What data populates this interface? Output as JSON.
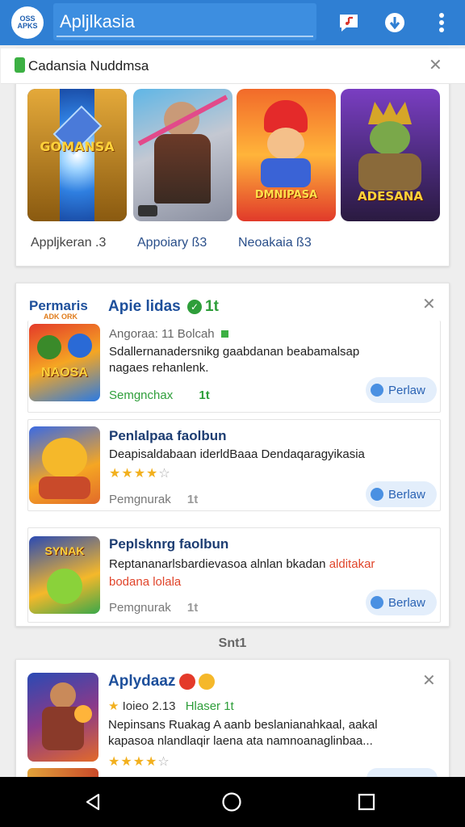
{
  "appbar": {
    "logo_text": "OSS APKS",
    "title": "Apljlkasia"
  },
  "collection": {
    "title": "Cadansia Nuddmsa",
    "tiles": [
      {
        "art_label": "GOMANSA",
        "caption": "Appljkeran .3"
      },
      {
        "art_label": "",
        "caption": "Appoiary ß3"
      },
      {
        "art_label": "DMNIPASA",
        "caption": "Neoakaia ß3"
      },
      {
        "art_label": "ADESANA",
        "caption": ""
      }
    ]
  },
  "recommend": {
    "head_label": "Permaris",
    "head_sub": "ADK ORK",
    "title": "Apie lidas",
    "extra": "1t",
    "rows": [
      {
        "icon_label": "NAOSA",
        "meta": "Angoraa: 11 Bolcah",
        "desc_1": "Sdallernanadersnikg gaabdanan beabamalsap",
        "desc_2": "nagaes rehanlenk.",
        "foot": "Semgnchax",
        "foot_extra": "1t",
        "button": "Perlaw"
      },
      {
        "title": "Penlalpaa faolbun",
        "desc_1": "Deapisaldabaan iderldBaaa Dendaqaragyikasia",
        "stars": "★★★★",
        "stars_empty": "☆",
        "foot": "Pemgnurak",
        "foot_extra": "1t",
        "button": "Berlaw"
      },
      {
        "icon_label": "SYNAK",
        "title": "Peplsknrg faolbun",
        "desc_1": "Reptananarlsbardievasoa alnlan bkadan",
        "desc_red_1": "alditakar",
        "desc_red_2": "bodana lolala",
        "foot": "Pemgnurak",
        "foot_extra": "1t",
        "button": "Berlaw"
      }
    ]
  },
  "section_label": "Snt1",
  "bottom_card": {
    "title": "Aplydaaz",
    "meta": "Ioieo 2.13",
    "meta_green": "Hlaser 1t",
    "desc_1": "Nepinsans Ruakag A aanb beslanianahkaal, aakal",
    "desc_2": "kapasoa nlandlaqir laena ata namnoanaglinbaa...",
    "stars": "★★★★",
    "stars_empty": "☆"
  },
  "colors": {
    "appbar": "#2f7fd3",
    "accent": "#2a63b4",
    "green": "#2e9e3a",
    "star": "#f2b01e"
  }
}
